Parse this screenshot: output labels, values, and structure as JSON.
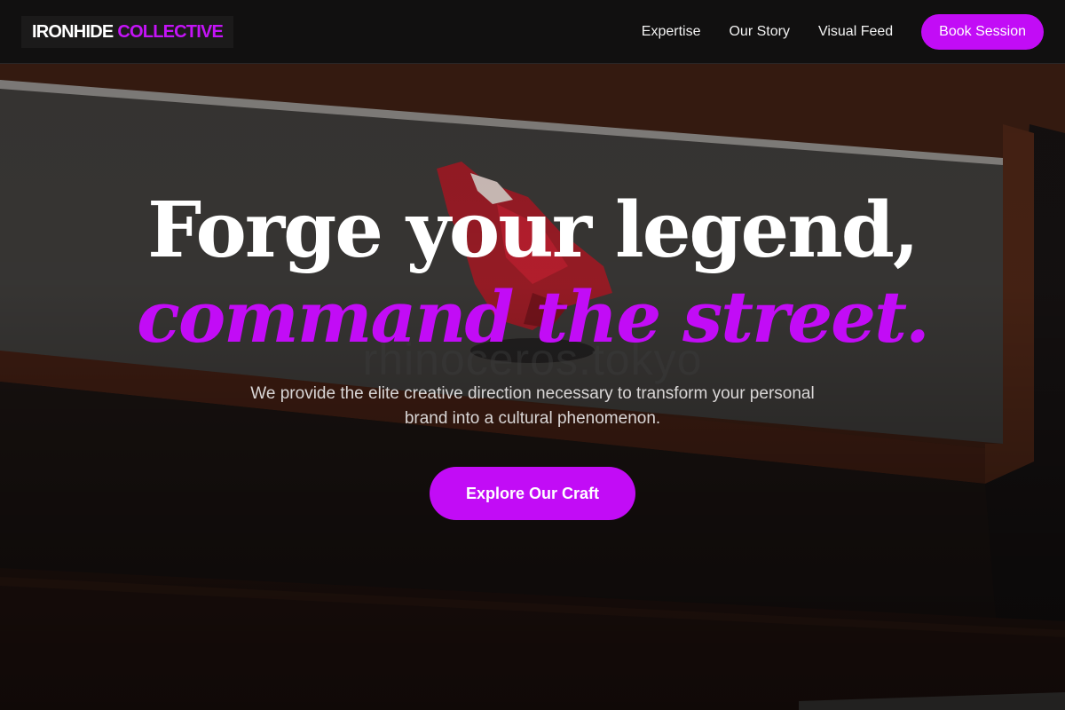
{
  "brand": {
    "name_part1": "IRONHIDE",
    "name_part2": "COLLECTIVE"
  },
  "nav": {
    "items": [
      {
        "label": "Expertise"
      },
      {
        "label": "Our Story"
      },
      {
        "label": "Visual Feed"
      }
    ],
    "cta_label": "Book Session"
  },
  "hero": {
    "headline_line1": "Forge your legend,",
    "headline_line2": "command the street.",
    "watermark": "rhinoceros.tokyo",
    "subtext": "We provide the elite creative direction necessary to transform your personal brand into a cultural phenomenon.",
    "cta_label": "Explore Our Craft",
    "background_image": "red-figure-on-stone-steps"
  },
  "colors": {
    "accent": "#c20cf6",
    "header_bg": "#111010",
    "text_primary": "#ffffff",
    "text_secondary": "#d9d6d6"
  }
}
